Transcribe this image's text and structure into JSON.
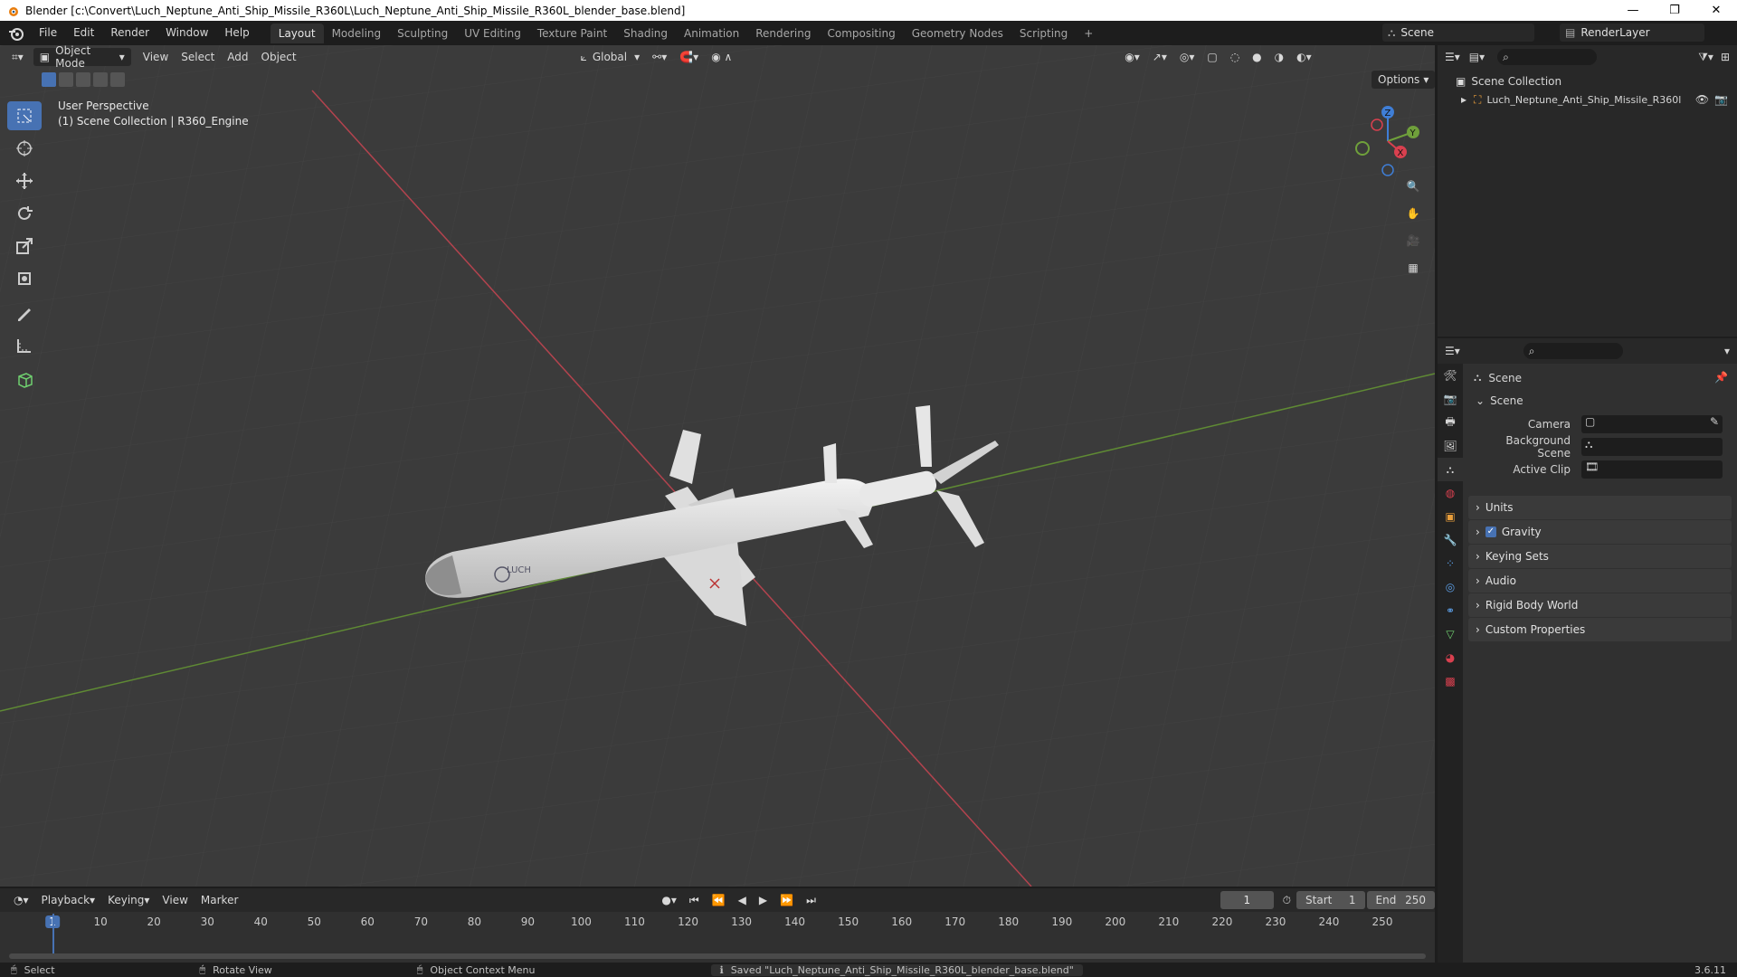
{
  "window": {
    "title": "Blender [c:\\Convert\\Luch_Neptune_Anti_Ship_Missile_R360L\\Luch_Neptune_Anti_Ship_Missile_R360L_blender_base.blend]",
    "minimize": "—",
    "maximize": "❐",
    "close": "✕"
  },
  "menus": [
    "File",
    "Edit",
    "Render",
    "Window",
    "Help"
  ],
  "workspaces": [
    "Layout",
    "Modeling",
    "Sculpting",
    "UV Editing",
    "Texture Paint",
    "Shading",
    "Animation",
    "Rendering",
    "Compositing",
    "Geometry Nodes",
    "Scripting"
  ],
  "active_workspace": "Layout",
  "scene_selector": {
    "value": "Scene"
  },
  "view_layer": {
    "value": "RenderLayer"
  },
  "viewport": {
    "mode": "Object Mode",
    "menus": [
      "View",
      "Select",
      "Add",
      "Object"
    ],
    "orientation": "Global",
    "options": "Options",
    "info_line1": "User Perspective",
    "info_line2": "(1) Scene Collection | R360_Engine",
    "gizmo": {
      "x": "X",
      "y": "Y",
      "z": "Z"
    }
  },
  "outliner": {
    "root": "Scene Collection",
    "items": [
      {
        "label": "Luch_Neptune_Anti_Ship_Missile_R360l"
      }
    ]
  },
  "properties": {
    "context": "Scene",
    "panel_title": "Scene",
    "fields": [
      {
        "label": "Camera"
      },
      {
        "label": "Background Scene"
      },
      {
        "label": "Active Clip"
      }
    ],
    "subpanels": [
      "Units",
      "Gravity",
      "Keying Sets",
      "Audio",
      "Rigid Body World",
      "Custom Properties"
    ],
    "gravity_checked": true
  },
  "timeline": {
    "menus": [
      "Playback",
      "Keying",
      "View",
      "Marker"
    ],
    "current_frame": "1",
    "start_label": "Start",
    "start": "1",
    "end_label": "End",
    "end": "250",
    "ticks": [
      "1",
      "10",
      "20",
      "30",
      "40",
      "50",
      "60",
      "70",
      "80",
      "90",
      "100",
      "110",
      "120",
      "130",
      "140",
      "150",
      "160",
      "170",
      "180",
      "190",
      "200",
      "210",
      "220",
      "230",
      "240",
      "250"
    ]
  },
  "statusbar": {
    "select": "Select",
    "rotate": "Rotate View",
    "context_menu": "Object Context Menu",
    "message": "Saved \"Luch_Neptune_Anti_Ship_Missile_R360L_blender_base.blend\"",
    "version": "3.6.11"
  },
  "colors": {
    "accent": "#4772b3",
    "x_axis": "#d9404f",
    "y_axis": "#6fa03b",
    "z_axis": "#3f7ed6"
  }
}
